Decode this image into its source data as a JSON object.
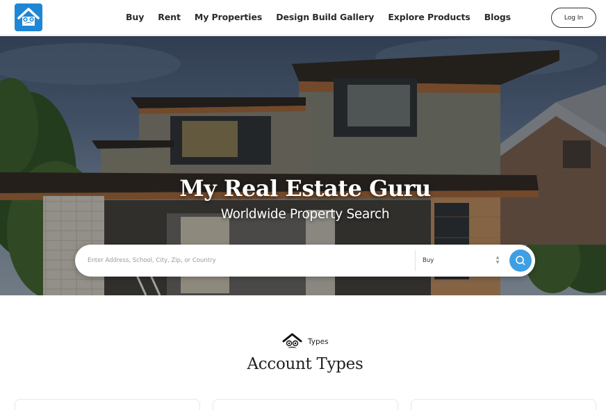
{
  "nav": {
    "items": [
      {
        "label": "Buy"
      },
      {
        "label": "Rent"
      },
      {
        "label": "My Properties"
      },
      {
        "label": "Design Build Gallery"
      },
      {
        "label": "Explore Products"
      },
      {
        "label": "Blogs"
      }
    ],
    "login_label": "Log In"
  },
  "hero": {
    "title": "My Real Estate Guru",
    "subtitle": "Worldwide Property Search"
  },
  "search": {
    "placeholder": "Enter Address, School, City, Zip, or Country",
    "value": "",
    "type_selected": "Buy",
    "button_icon": "search-icon"
  },
  "section": {
    "tag": "Types",
    "tag_icon": "guru-house-icon",
    "title": "Account Types"
  },
  "colors": {
    "brand": "#1f86d6",
    "search_button": "#3f9fe3",
    "text": "#222222"
  }
}
